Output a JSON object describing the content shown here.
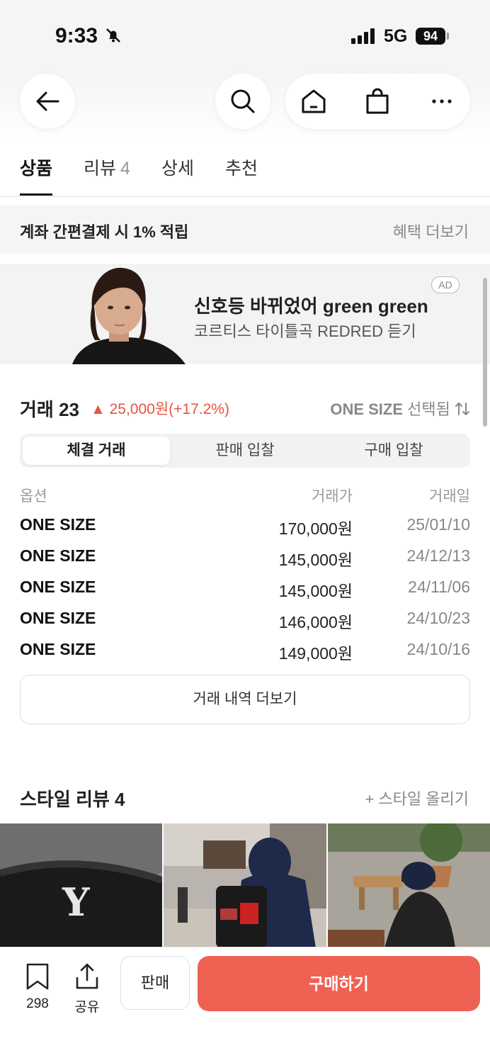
{
  "status_bar": {
    "time": "9:33",
    "network": "5G",
    "battery": "94"
  },
  "tabs": [
    {
      "label": "상품",
      "count": ""
    },
    {
      "label": "리뷰",
      "count": "4"
    },
    {
      "label": "상세",
      "count": ""
    },
    {
      "label": "추천",
      "count": ""
    }
  ],
  "benefit": {
    "text": "계좌 간편결제 시 1% 적립",
    "link": "혜택 더보기"
  },
  "ad": {
    "title": "신호등 바뀌었어 green green",
    "subtitle": "코르티스 타이틀곡 REDRED 듣기",
    "badge": "AD"
  },
  "trades": {
    "title": "거래 23",
    "change": "▲ 25,000원(+17.2%)",
    "size": "ONE SIZE",
    "size_suffix": "선택됨",
    "segments": [
      "체결 거래",
      "판매 입찰",
      "구매 입찰"
    ],
    "columns": [
      "옵션",
      "거래가",
      "거래일"
    ],
    "rows": [
      {
        "option": "ONE SIZE",
        "price": "170,000원",
        "date": "25/01/10"
      },
      {
        "option": "ONE SIZE",
        "price": "145,000원",
        "date": "24/12/13"
      },
      {
        "option": "ONE SIZE",
        "price": "145,000원",
        "date": "24/11/06"
      },
      {
        "option": "ONE SIZE",
        "price": "146,000원",
        "date": "24/10/23"
      },
      {
        "option": "ONE SIZE",
        "price": "149,000원",
        "date": "24/10/16"
      }
    ],
    "more": "거래 내역 더보기"
  },
  "style_review": {
    "title": "스타일 리뷰 4",
    "upload": "+ 스타일 올리기"
  },
  "bottom": {
    "bookmark_count": "298",
    "share_label": "공유",
    "sell_label": "판매",
    "buy_label": "구매하기"
  },
  "colors": {
    "accent": "#ef6253",
    "price_up": "#e8543f"
  }
}
